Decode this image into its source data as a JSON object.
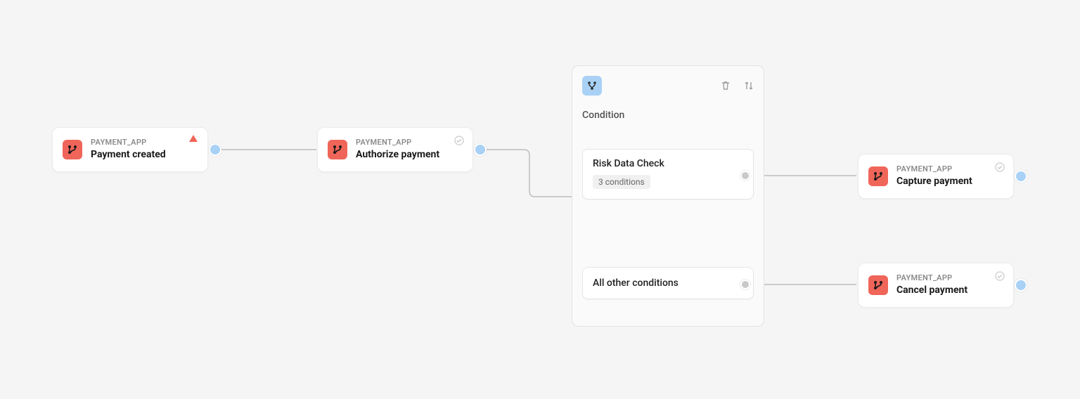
{
  "nodes": {
    "payment_created": {
      "app": "PAYMENT_APP",
      "title": "Payment created"
    },
    "authorize": {
      "app": "PAYMENT_APP",
      "title": "Authorize payment"
    },
    "capture": {
      "app": "PAYMENT_APP",
      "title": "Capture payment"
    },
    "cancel": {
      "app": "PAYMENT_APP",
      "title": "Cancel payment"
    }
  },
  "condition": {
    "title": "Condition",
    "branches": {
      "risk": {
        "name": "Risk Data Check",
        "badge": "3 conditions"
      },
      "other": {
        "name": "All other conditions"
      }
    }
  },
  "icons": {
    "flow_node": "git-branch-icon",
    "condition": "branch-split-icon",
    "trash": "trash-icon",
    "reorder": "reorder-icon",
    "warning": "warning-triangle-icon",
    "check": "check-circle-icon"
  },
  "colors": {
    "node_icon_bg": "#f06559",
    "handle": "#a8d1f5",
    "branch_handle": "#c9c9c9"
  }
}
